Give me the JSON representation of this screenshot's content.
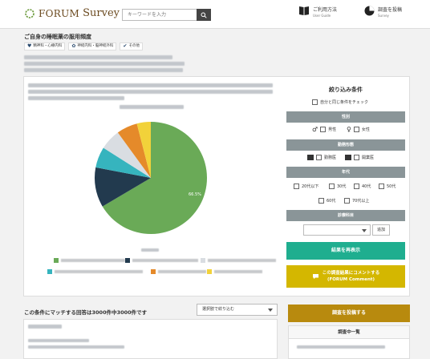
{
  "header": {
    "logo_prefix": "FORUM",
    "logo_suffix": "Survey",
    "search_placeholder": "キーワードを入力",
    "nav": [
      {
        "label": "ご利用方法",
        "sub": "User Guide",
        "icon": "book-icon"
      },
      {
        "label": "調査を投稿",
        "sub": "Survey",
        "icon": "pie-chart-icon"
      }
    ]
  },
  "page": {
    "title": "ご自身の睡眠薬の服用頻度",
    "tags": [
      "精神科・心療内科",
      "神経内科・脳神経外科",
      "その他"
    ]
  },
  "chart_data": {
    "type": "pie",
    "colors": [
      "#6aaa57",
      "#223a4e",
      "#36b4be",
      "#d9dde2",
      "#e58a2a",
      "#f2d23a"
    ],
    "slice_fractions": [
      0.665,
      0.115,
      0.06,
      0.06,
      0.06,
      0.04
    ],
    "data_label": "66.5%"
  },
  "filters": {
    "title": "絞り込み条件",
    "same_condition": "自分と同じ条件をチェック",
    "gender": {
      "header": "性別",
      "options": [
        "男性",
        "女性"
      ]
    },
    "work": {
      "header": "勤務形態",
      "options": [
        "勤務医",
        "開業医"
      ]
    },
    "age": {
      "header": "年代",
      "options": [
        "20代以下",
        "30代",
        "40代",
        "50代",
        "60代",
        "70代以上"
      ]
    },
    "department": {
      "header": "診療科目",
      "add": "追加"
    },
    "redisplay": "結果を再表示",
    "comment_line1": "この調査結果にコメントする",
    "comment_line2": "(FORUM Comment)"
  },
  "bottom": {
    "count_text": "この条件にマッチする回答は3000件中3000件です",
    "sort_label": "選択肢で絞り込む",
    "post_button": "調査を投稿する",
    "list_title": "調査中一覧"
  }
}
